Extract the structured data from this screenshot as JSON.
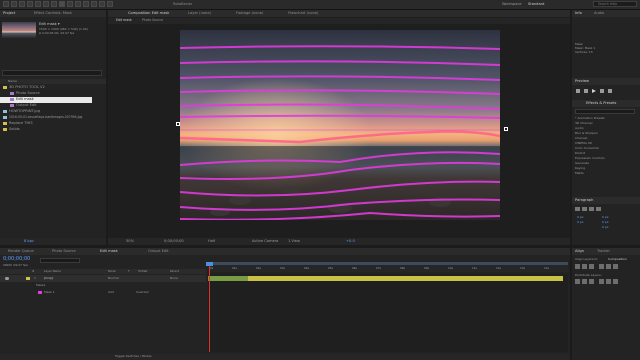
{
  "app": {
    "title": "Untitled Project.aep",
    "workspace_label": "Workspace",
    "workspace_value": "Standard",
    "search_placeholder": "Search Help",
    "rotobrush_label": "RotoBezier",
    "accent": "#4a90e2"
  },
  "project_panel": {
    "tab": "Project",
    "tab2": "Effect Controls: Mask",
    "preview": {
      "name": "Edit mask ▾",
      "line1": "1500 × 1000 (960 × 540) (1.00)",
      "line2": "Δ 0;00;05;00, 29.97 fps"
    },
    "search_placeholder": "",
    "col_name": "Name",
    "items": [
      {
        "name": "3D PHOTO TOOL V2",
        "kind": "folder",
        "color": "#d1c14b"
      },
      {
        "name": "Photo Source",
        "kind": "comp",
        "color": "#a57acb"
      },
      {
        "name": "Edit mask",
        "kind": "comp",
        "color": "#a57acb",
        "selected": true
      },
      {
        "name": "Output Edit",
        "kind": "comp",
        "color": "#a57acb"
      },
      {
        "name": "HOWTOPRINT.jpg",
        "kind": "file",
        "color": "#8bc0e0"
      },
      {
        "name": "2016-09-01-toscaftaya-bantimages-007994.jpg",
        "kind": "file",
        "color": "#8bc0e0"
      },
      {
        "name": "Replace THIS",
        "kind": "folder",
        "color": "#d1c14b"
      },
      {
        "name": "Solids",
        "kind": "folder",
        "color": "#d1c14b"
      }
    ],
    "footer": "8 bpc"
  },
  "composition_panel": {
    "tabs": [
      "Composition Edit mask",
      "Layer (none)",
      "Footage (none)",
      "Flowchart (none)"
    ],
    "subtabs": [
      "Edit mask",
      "Photo Source"
    ],
    "footer": {
      "zoom": "50%",
      "timecode": "0;00;00;00",
      "resolution": "Half",
      "camera": "Active Camera",
      "views": "1 View",
      "offset": "+0.0"
    }
  },
  "right_panel": {
    "info_tab": "Info",
    "audio_tab": "Audio",
    "info_lines": [
      "Mask",
      "Mask: Mask 1",
      "Vertices: 15"
    ],
    "preview_tab": "Preview",
    "effects_tab": "Effects & Presets",
    "effects_search_placeholder": "",
    "effects": [
      "* Animation Presets",
      "3D Channel",
      "Audio",
      "Blur & Sharpen",
      "Channel",
      "CINEMA 4D",
      "Color Correction",
      "Distort",
      "Expression Controls",
      "Generate",
      "Keying",
      "Matte"
    ],
    "paragraph_tab": "Paragraph",
    "paragraph_values": [
      "0 px",
      "0 px",
      "0 px",
      "0 px",
      "0 px"
    ],
    "align_tab": "Align",
    "tracker_tab": "Tracker",
    "align_layers_to": "Align Layers to:",
    "align_target": "Composition",
    "distribute_layers": "Distribute Layers:"
  },
  "timeline": {
    "tabs": [
      "Render Queue",
      "Photo Source",
      "Edit mask",
      "Output Edit"
    ],
    "timecode": "0;00;00;00",
    "fps_hint": "00000 (29.97 fps)",
    "columns": [
      "#",
      "Layer Name",
      "Mode",
      "T",
      "TrkMat",
      "Parent"
    ],
    "layers": [
      {
        "num": "1",
        "name": "[Crop]",
        "mode": "Normal",
        "trkmat": "",
        "parent": "None"
      }
    ],
    "sub_rows": [
      {
        "name": "Masks"
      },
      {
        "name": "Mask 1",
        "mode": "Add",
        "extra": "Inverted"
      }
    ],
    "ruler": [
      "0s",
      "01s",
      "02s",
      "03s",
      "04s",
      "05s",
      "06s",
      "07s",
      "08s",
      "09s",
      "10s",
      "11s",
      "12s",
      "13s",
      "14s"
    ],
    "footer": "Toggle Switches / Modes"
  },
  "toolbar": {
    "snapping": "Snapping"
  }
}
